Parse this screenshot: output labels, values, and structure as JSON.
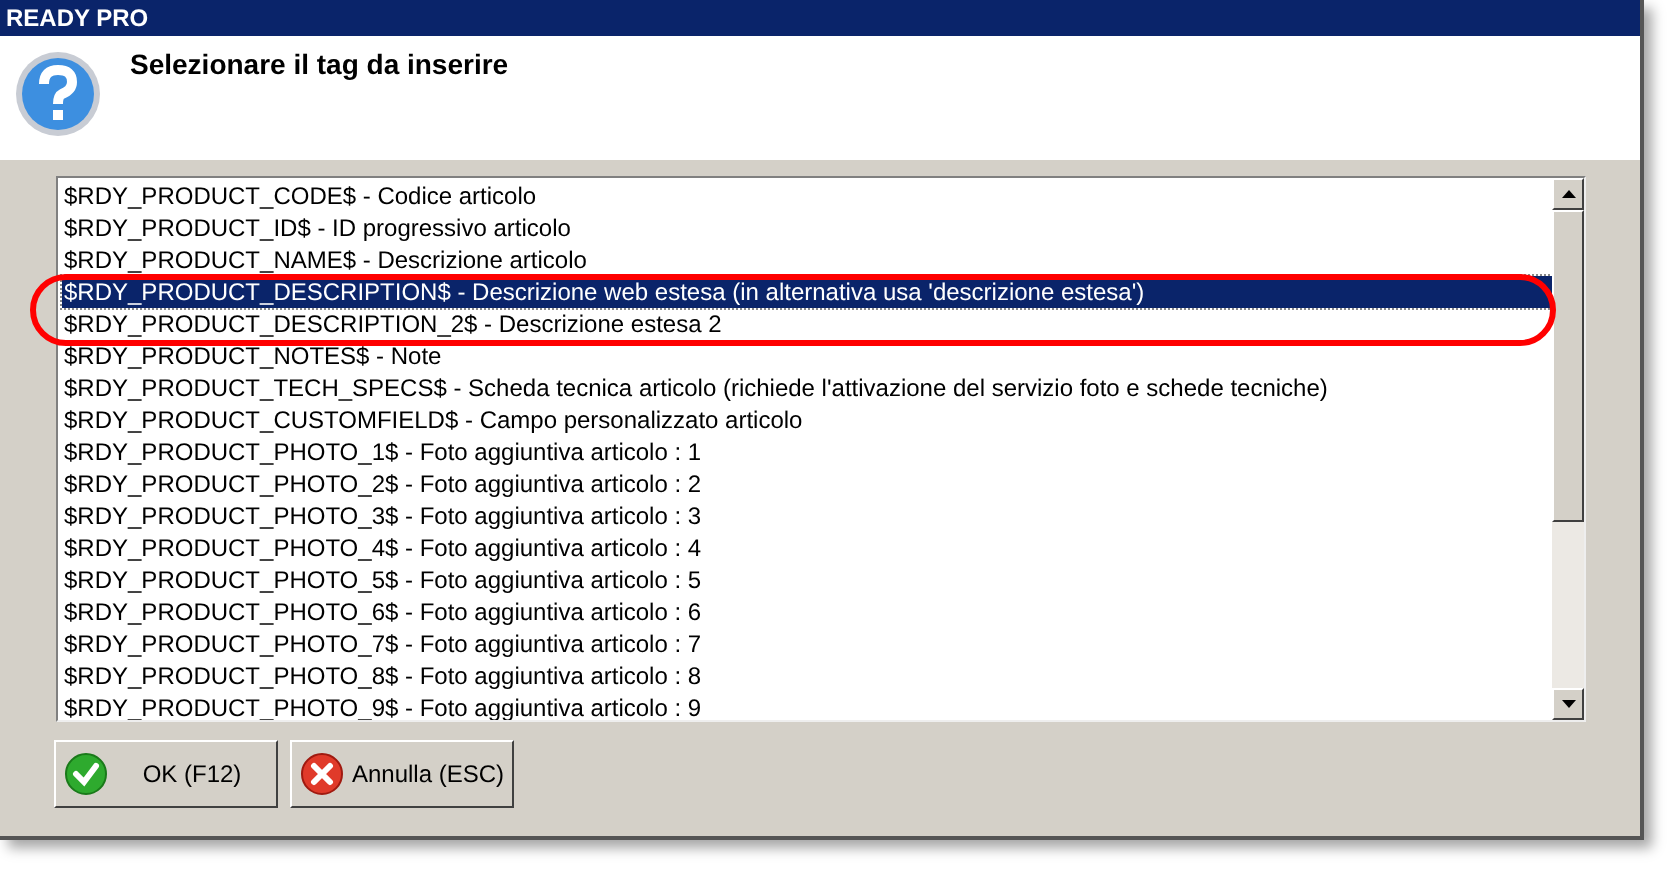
{
  "window": {
    "title": "READY PRO"
  },
  "header": {
    "title": "Selezionare il tag da inserire"
  },
  "list": {
    "items": [
      {
        "label": "$RDY_PRODUCT_CODE$ - Codice articolo",
        "selected": false,
        "circled": false
      },
      {
        "label": "$RDY_PRODUCT_ID$ - ID progressivo articolo",
        "selected": false,
        "circled": false
      },
      {
        "label": "$RDY_PRODUCT_NAME$ - Descrizione articolo",
        "selected": false,
        "circled": false
      },
      {
        "label": "$RDY_PRODUCT_DESCRIPTION$ - Descrizione web estesa (in alternativa usa 'descrizione estesa')",
        "selected": true,
        "circled": true
      },
      {
        "label": "$RDY_PRODUCT_DESCRIPTION_2$ - Descrizione estesa 2",
        "selected": false,
        "circled": true
      },
      {
        "label": "$RDY_PRODUCT_NOTES$ - Note",
        "selected": false,
        "circled": false
      },
      {
        "label": "$RDY_PRODUCT_TECH_SPECS$ - Scheda tecnica articolo (richiede l'attivazione del servizio foto e schede tecniche)",
        "selected": false,
        "circled": false
      },
      {
        "label": "$RDY_PRODUCT_CUSTOMFIELD$ - Campo personalizzato articolo",
        "selected": false,
        "circled": false
      },
      {
        "label": "$RDY_PRODUCT_PHOTO_1$ - Foto aggiuntiva articolo : 1",
        "selected": false,
        "circled": false
      },
      {
        "label": "$RDY_PRODUCT_PHOTO_2$ - Foto aggiuntiva articolo : 2",
        "selected": false,
        "circled": false
      },
      {
        "label": "$RDY_PRODUCT_PHOTO_3$ - Foto aggiuntiva articolo : 3",
        "selected": false,
        "circled": false
      },
      {
        "label": "$RDY_PRODUCT_PHOTO_4$ - Foto aggiuntiva articolo : 4",
        "selected": false,
        "circled": false
      },
      {
        "label": "$RDY_PRODUCT_PHOTO_5$ - Foto aggiuntiva articolo : 5",
        "selected": false,
        "circled": false
      },
      {
        "label": "$RDY_PRODUCT_PHOTO_6$ - Foto aggiuntiva articolo : 6",
        "selected": false,
        "circled": false
      },
      {
        "label": "$RDY_PRODUCT_PHOTO_7$ - Foto aggiuntiva articolo : 7",
        "selected": false,
        "circled": false
      },
      {
        "label": "$RDY_PRODUCT_PHOTO_8$ - Foto aggiuntiva articolo : 8",
        "selected": false,
        "circled": false
      },
      {
        "label": "$RDY_PRODUCT_PHOTO_9$ - Foto aggiuntiva articolo : 9",
        "selected": false,
        "circled": false
      }
    ]
  },
  "buttons": [
    {
      "kind": "ok",
      "label": "OK (F12)"
    },
    {
      "kind": "cancel",
      "label": "Annulla (ESC)"
    }
  ]
}
